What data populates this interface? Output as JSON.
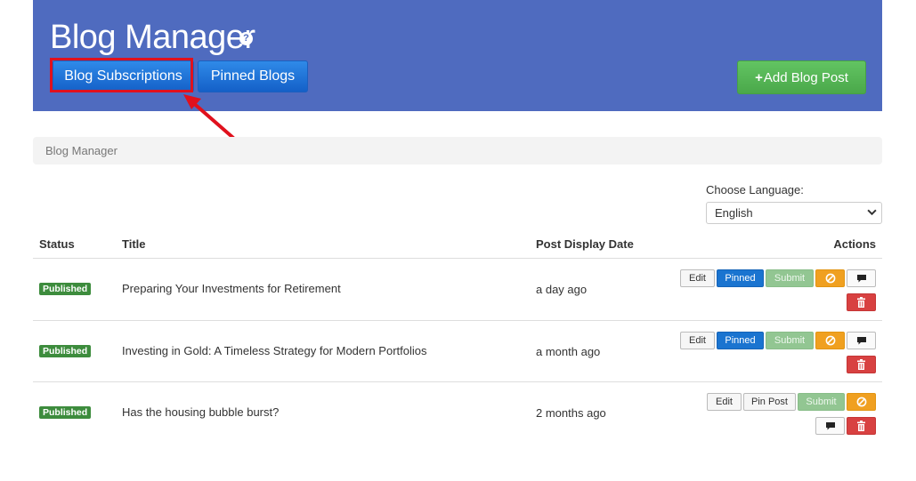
{
  "header": {
    "title": "Blog Manager",
    "help_icon": "?",
    "buttons": {
      "subscriptions": "Blog Subscriptions",
      "pinned": "Pinned Blogs",
      "add": "Add Blog Post",
      "add_icon": "+"
    }
  },
  "breadcrumb": "Blog Manager",
  "language": {
    "label": "Choose Language:",
    "selected": "English"
  },
  "table": {
    "headers": {
      "status": "Status",
      "title": "Title",
      "date": "Post Display Date",
      "actions": "Actions"
    },
    "rows": [
      {
        "status": "Published",
        "title": "Preparing Your Investments for Retirement",
        "date": "a day ago",
        "actions": {
          "edit": "Edit",
          "pin": "Pinned",
          "submit": "Submit"
        }
      },
      {
        "status": "Published",
        "title": "Investing in Gold: A Timeless Strategy for Modern Portfolios",
        "date": "a month ago",
        "actions": {
          "edit": "Edit",
          "pin": "Pinned",
          "submit": "Submit"
        }
      },
      {
        "status": "Published",
        "title": "Has the housing bubble burst?",
        "date": "2 months ago",
        "actions": {
          "edit": "Edit",
          "pin": "Pin Post",
          "submit": "Submit"
        }
      }
    ]
  },
  "colors": {
    "header": "#4f6bbf",
    "primary": "#1a74d0",
    "success": "#4aa84a",
    "warning": "#f0a020",
    "danger": "#d84141",
    "annotation": "#e0111d"
  }
}
